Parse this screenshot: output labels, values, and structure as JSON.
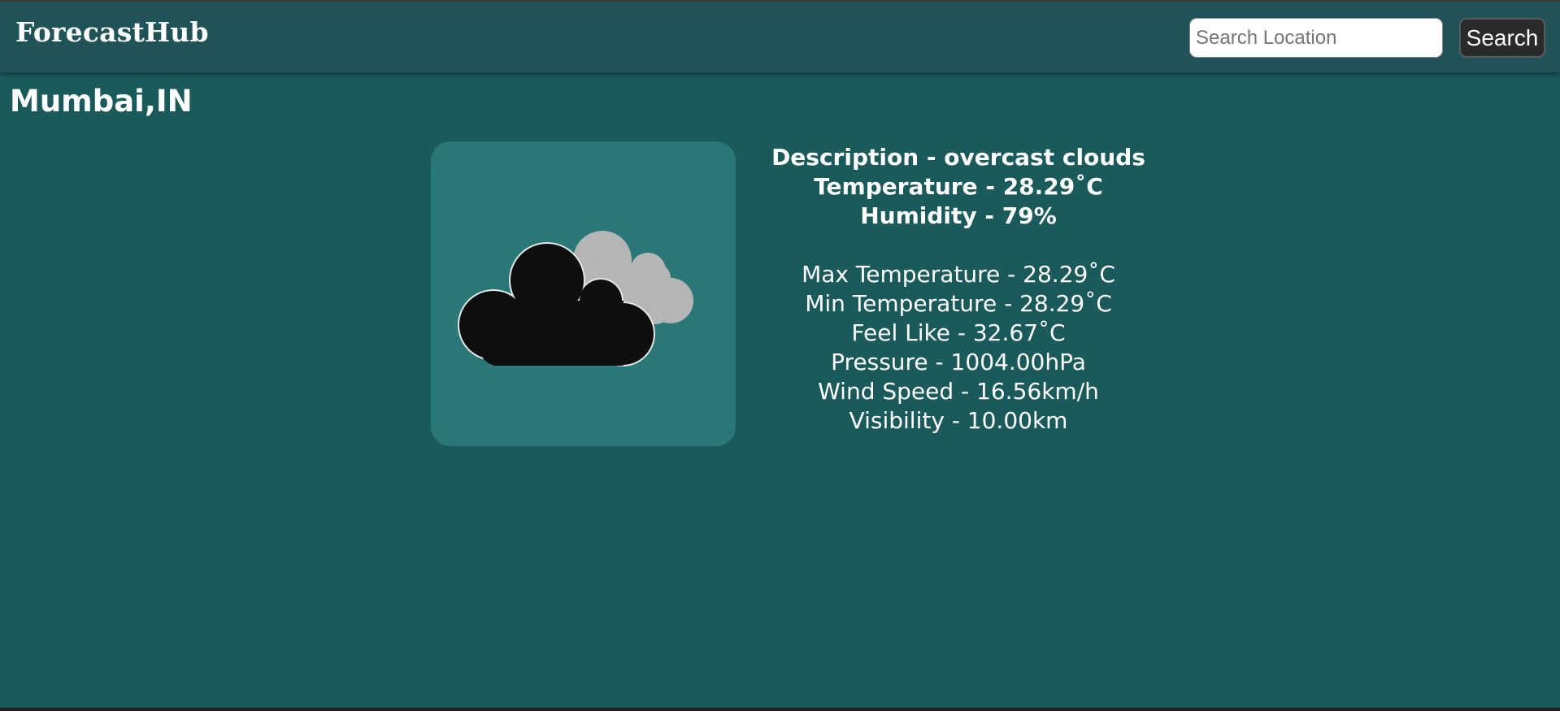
{
  "header": {
    "brand": "ForecastHub",
    "search": {
      "placeholder": "Search Location",
      "value": ""
    },
    "search_button": "Search"
  },
  "location": {
    "label": "Mumbai,IN"
  },
  "weather": {
    "icon": "overcast-clouds-icon",
    "primary": [
      "Description - overcast clouds",
      "Temperature - 28.29˚C",
      "Humidity - 79%"
    ],
    "details": [
      "Max Temperature - 28.29˚C",
      "Min Temperature - 28.29˚C",
      "Feel Like - 32.67˚C",
      "Pressure - 1004.00hPa",
      "Wind Speed - 16.56km/h",
      "Visibility - 10.00km"
    ]
  },
  "colors": {
    "background": "#1b5a5b",
    "navbar": "#205357",
    "icon_card": "#2a7778",
    "text": "#ffffff",
    "cloud_front": "#0e0e0e",
    "cloud_back": "#b5b5b5"
  }
}
